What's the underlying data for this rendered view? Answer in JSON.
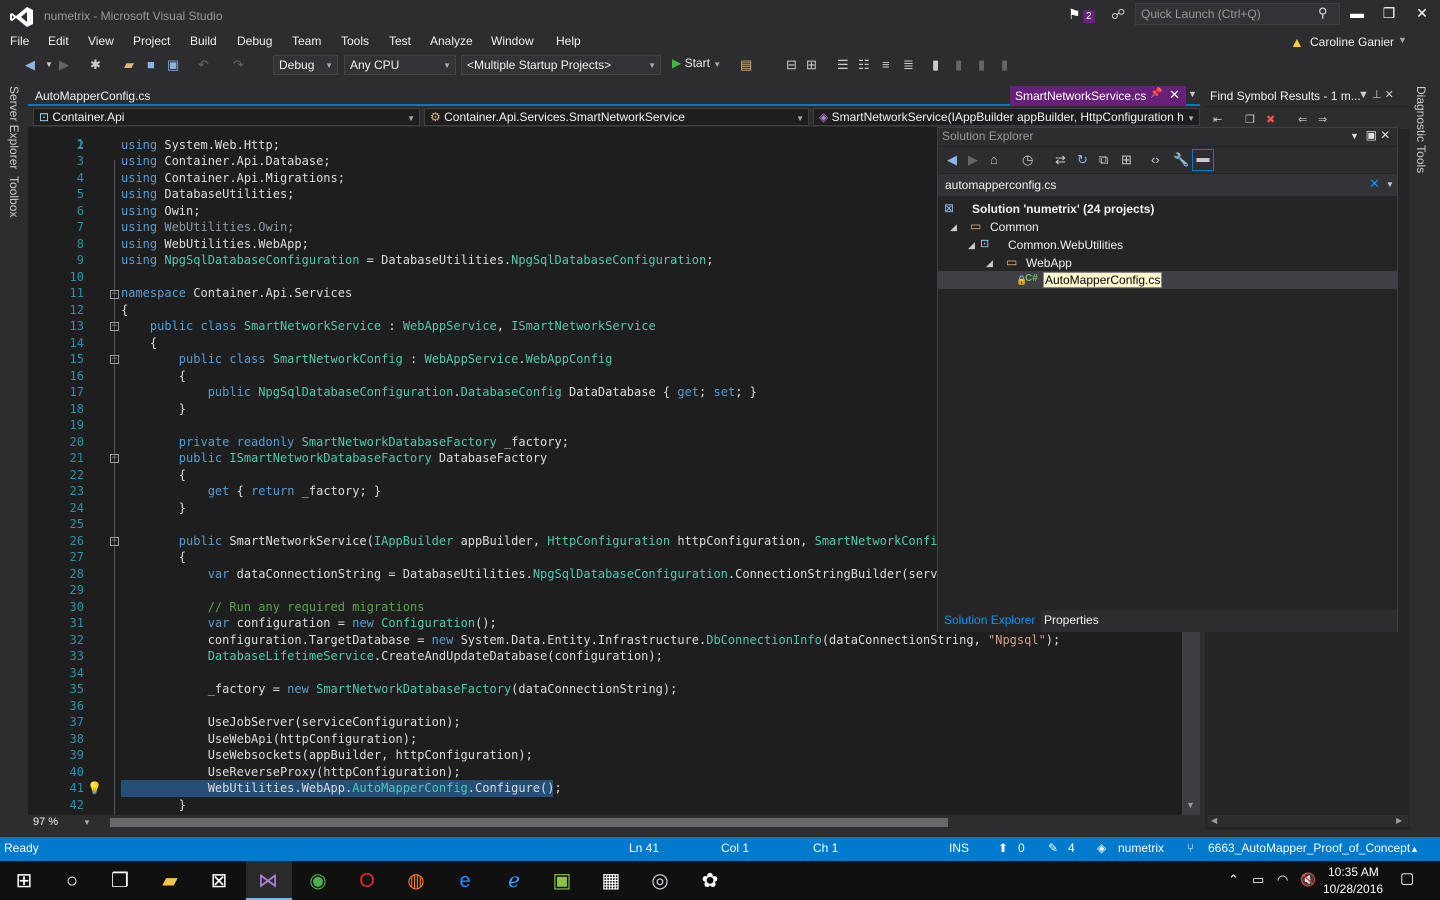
{
  "window": {
    "title": "numetrix - Microsoft Visual Studio",
    "notification_count": "2",
    "quick_launch_placeholder": "Quick Launch (Ctrl+Q)",
    "user": "Caroline Ganier",
    "controls": {
      "minimize": "▬",
      "restore": "❐",
      "close": "✕"
    }
  },
  "menu": [
    "File",
    "Edit",
    "View",
    "Project",
    "Build",
    "Debug",
    "Team",
    "Tools",
    "Test",
    "Analyze",
    "Window",
    "Help"
  ],
  "toolbar": {
    "config": "Debug",
    "platform": "Any CPU",
    "startup": "<Multiple Startup Projects>",
    "start_label": "Start"
  },
  "left_tabs": [
    "Server Explorer",
    "Toolbox"
  ],
  "editor": {
    "preview_tab": "AutoMapperConfig.cs",
    "active_tab": "SmartNetworkService.cs",
    "nav_project": "Container.Api",
    "nav_class": "Container.Api.Services.SmartNetworkService",
    "nav_member": "SmartNetworkService(IAppBuilder appBuilder, HttpConfiguration h",
    "zoom": "97 %",
    "line_numbers": [
      "1",
      "2",
      "3",
      "4",
      "5",
      "6",
      "7",
      "8",
      "9",
      "10",
      "11",
      "12",
      "13",
      "14",
      "15",
      "16",
      "17",
      "18",
      "19",
      "20",
      "21",
      "22",
      "23",
      "24",
      "25",
      "26",
      "27",
      "28",
      "29",
      "30",
      "31",
      "32",
      "33",
      "34",
      "35",
      "36",
      "37",
      "38",
      "39",
      "40",
      "41",
      "42"
    ]
  },
  "find_symbol": {
    "title": "Find Symbol Results - 1 m..."
  },
  "solution_explorer": {
    "title": "Solution Explorer",
    "search_value": "automapperconfig.cs",
    "tree": {
      "solution": "Solution 'numetrix' (24 projects)",
      "folder_common": "Common",
      "project": "Common.WebUtilities",
      "folder_webapp": "WebApp",
      "file": "AutoMapperConfig.cs"
    },
    "tabs": [
      "Solution Explorer",
      "Properties"
    ]
  },
  "right_tabs": [
    "Diagnostic Tools"
  ],
  "status": {
    "ready": "Ready",
    "ln": "Ln 41",
    "col": "Col 1",
    "ch": "Ch 1",
    "ins": "INS",
    "up": "0",
    "pencil": "4",
    "repo": "numetrix",
    "branch": "6663_AutoMapper_Proof_of_Concept"
  },
  "taskbar": {
    "time": "10:35 AM",
    "date": "10/28/2016"
  },
  "colors": {
    "accent": "#007acc",
    "tab_active": "#68217a",
    "selection": "#264f78"
  }
}
